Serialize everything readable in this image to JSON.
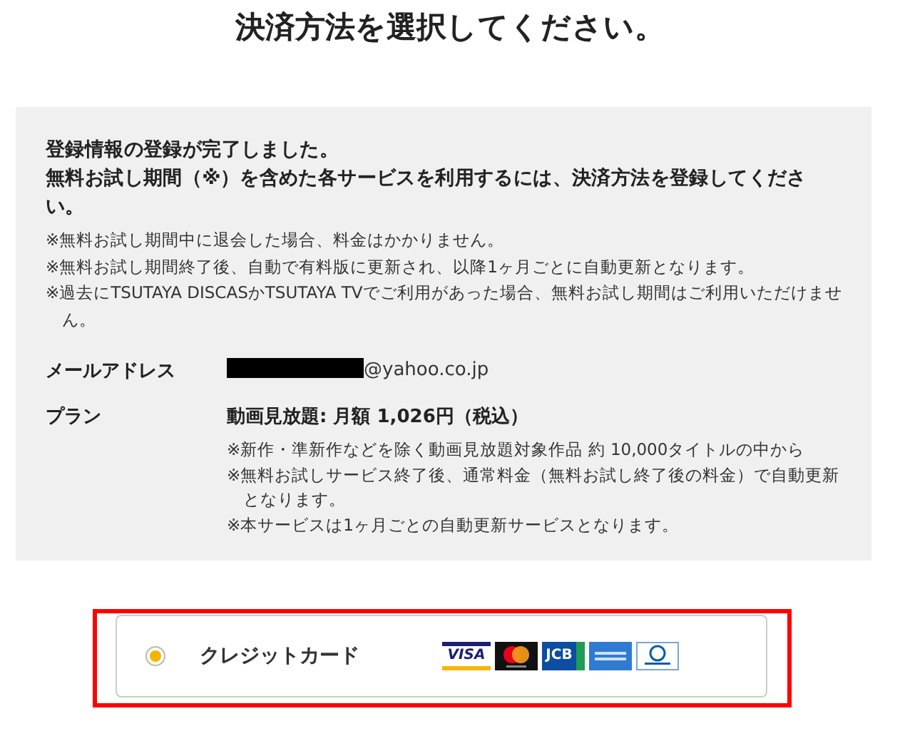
{
  "title": "決済方法を選択してください。",
  "notice": {
    "headline": [
      "登録情報の登録が完了しました。",
      "無料お試し期間（※）を含めた各サービスを利用するには、決済方法を登録してください。"
    ],
    "notes": [
      "※無料お試し期間中に退会した場合、料金はかかりません。",
      "※無料お試し期間終了後、自動で有料版に更新され、以降1ヶ月ごとに自動更新となります。",
      "※過去にTSUTAYA DISCASかTSUTAYA TVでご利用があった場合、無料お試し期間はご利用いただけません。"
    ]
  },
  "details": [
    {
      "kind": "email",
      "label": "メールアドレス",
      "value": "@yahoo.co.jp",
      "redacted": true
    },
    {
      "kind": "plan",
      "label": "プラン",
      "value": "動画見放題: 月額 1,026円（税込）",
      "notes": [
        "※新作・準新作などを除く動画見放題対象作品 約 10,000タイトルの中から",
        "※無料お試しサービス終了後、通常料金（無料お試し終了後の料金）で自動更新となります。",
        "※本サービスは1ヶ月ごとの自動更新サービスとなります。"
      ]
    }
  ],
  "payment_options": [
    {
      "label": "クレジットカード",
      "selected": true,
      "highlighted": true,
      "cards": [
        {
          "kind": "visa",
          "text": "VISA"
        },
        {
          "kind": "mastercard"
        },
        {
          "kind": "jcb",
          "text": "JCB"
        },
        {
          "kind": "amex"
        },
        {
          "kind": "diners"
        }
      ]
    }
  ]
}
